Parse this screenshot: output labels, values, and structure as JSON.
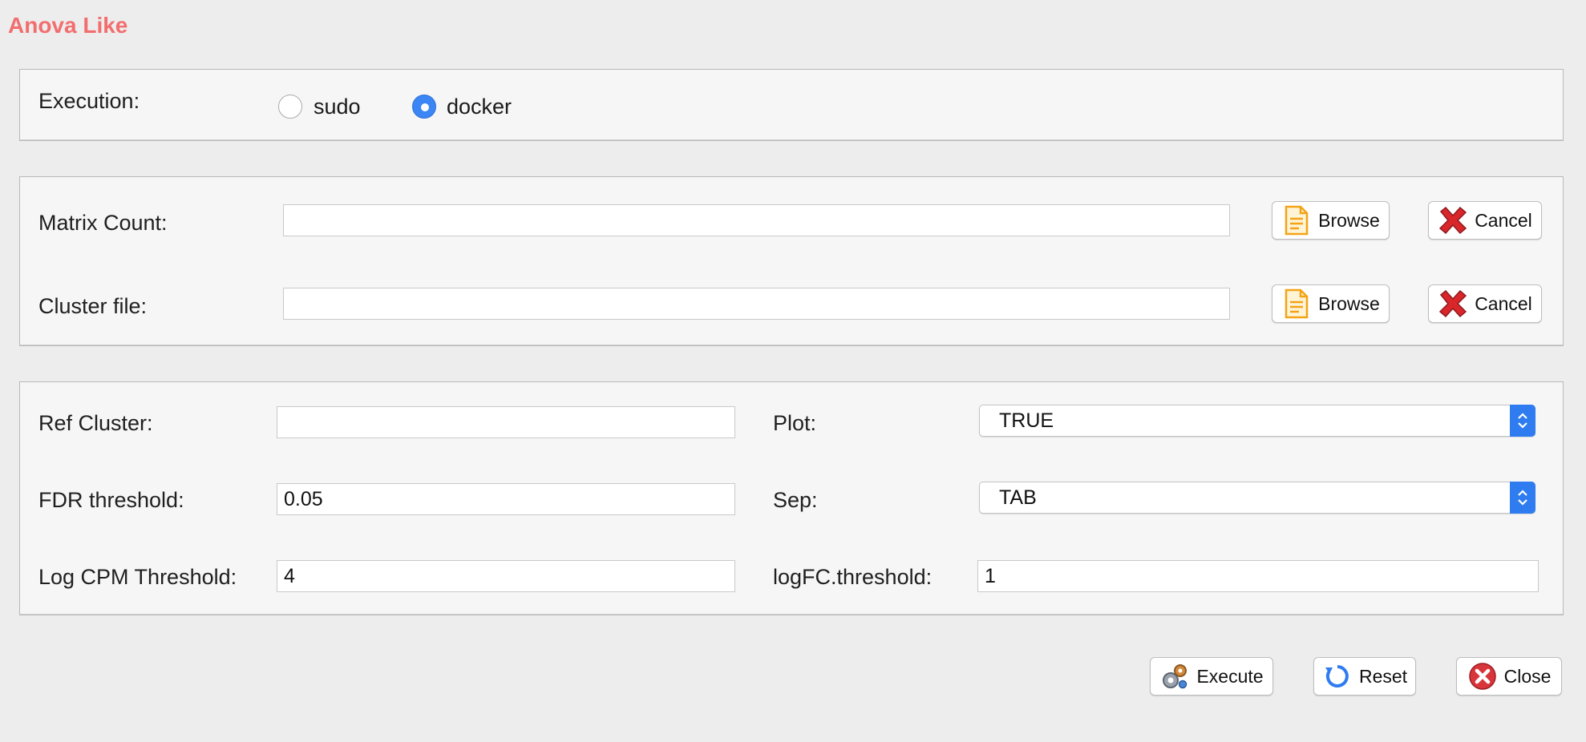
{
  "window": {
    "title": "Anova Like"
  },
  "execution": {
    "label": "Execution:",
    "options": [
      {
        "label": "sudo",
        "selected": false
      },
      {
        "label": "docker",
        "selected": true
      }
    ]
  },
  "files": {
    "matrix_count": {
      "label": "Matrix Count:",
      "value": "",
      "browse": "Browse",
      "cancel": "Cancel"
    },
    "cluster_file": {
      "label": "Cluster file:",
      "value": "",
      "browse": "Browse",
      "cancel": "Cancel"
    }
  },
  "params": {
    "ref_cluster": {
      "label": "Ref Cluster:",
      "value": ""
    },
    "fdr_threshold": {
      "label": "FDR threshold:",
      "value": "0.05"
    },
    "log_cpm_threshold": {
      "label": "Log CPM Threshold:",
      "value": "4"
    },
    "plot": {
      "label": "Plot:",
      "selected": "TRUE"
    },
    "sep": {
      "label": "Sep:",
      "selected": "TAB"
    },
    "logfc_threshold": {
      "label": "logFC.threshold:",
      "value": "1"
    }
  },
  "actions": {
    "execute": "Execute",
    "reset": "Reset",
    "close": "Close"
  },
  "colors": {
    "title": "#f26e6e",
    "accent": "#3b86f5"
  },
  "icons": {
    "browse": "document-icon",
    "cancel": "red-x-icon",
    "execute": "gears-icon",
    "reset": "refresh-icon",
    "close": "close-circle-icon",
    "select": "chevron-updown-icon"
  }
}
